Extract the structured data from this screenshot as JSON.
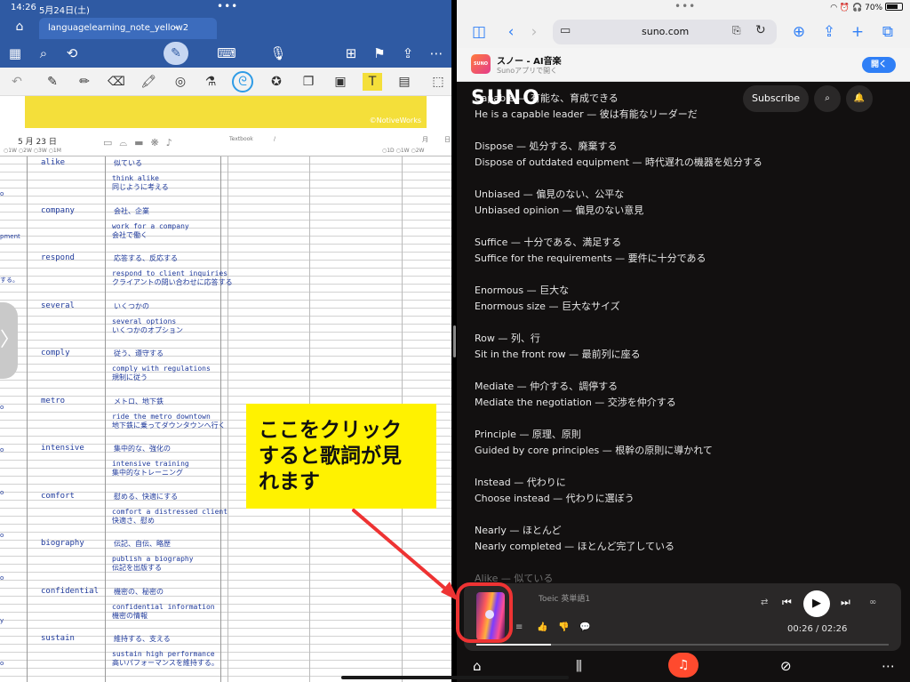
{
  "left": {
    "status": {
      "time": "14:26",
      "date": "5月24日(土)"
    },
    "tab_title": "languagelearning_note_yellow2",
    "watermark": "©NotiveWorks",
    "notebook": {
      "date_month": "5",
      "date_label": "月",
      "date_day": "23",
      "date_suffix": "日",
      "radios_left": "○1W  ○2W  ○3W  ○1M",
      "radios_right": "○1D  ○1W  ○2W",
      "textbook": "Textbook",
      "slash": "/",
      "right_month": "月",
      "right_day": "日"
    },
    "entries": [
      {
        "word": "alike",
        "meaning": "似ている",
        "ex1": "think alike",
        "ex2": "同じように考える"
      },
      {
        "word": "company",
        "meaning": "会社、企業",
        "ex1": "work for a company",
        "ex2": "会社で働く"
      },
      {
        "word": "respond",
        "meaning": "応答する、反応する",
        "ex1": "respond to client inquiries",
        "ex2": "クライアントの問い合わせに応答する"
      },
      {
        "word": "several",
        "meaning": "いくつかの",
        "ex1": "several options",
        "ex2": "いくつかのオプション"
      },
      {
        "word": "comply",
        "meaning": "従う、遵守する",
        "ex1": "comply with regulations",
        "ex2": "規制に従う"
      },
      {
        "word": "metro",
        "meaning": "メトロ、地下鉄",
        "ex1": "ride the metro downtown",
        "ex2": "地下鉄に乗ってダウンタウンへ行く"
      },
      {
        "word": "intensive",
        "meaning": "集中的な、強化の",
        "ex1": "intensive training",
        "ex2": "集中的なトレーニング"
      },
      {
        "word": "comfort",
        "meaning": "慰める、快適にする",
        "ex1": "comfort a distressed client",
        "ex2": "快適さ、慰め"
      },
      {
        "word": "biography",
        "meaning": "伝記、自伝、略歴",
        "ex1": "publish a biography",
        "ex2": "伝記を出版する"
      },
      {
        "word": "confidential",
        "meaning": "機密の、秘密の",
        "ex1": "confidential information",
        "ex2": "機密の情報"
      },
      {
        "word": "sustain",
        "meaning": "維持する、支える",
        "ex1": "sustain high performance",
        "ex2": "高いパフォーマンスを維持する。"
      }
    ],
    "edge_fragments": [
      "o",
      "pment",
      "する。",
      "o",
      "o",
      "o",
      "o",
      "o",
      "o",
      "o",
      "y",
      "o"
    ],
    "callout": [
      "ここをクリック",
      "すると歌詞が見",
      "れます"
    ]
  },
  "right": {
    "status": {
      "battery": "70%"
    },
    "url": "suno.com",
    "app_banner": {
      "title": "スノー - AI音楽",
      "subtitle": "Sunoアプリで開く",
      "open": "開く",
      "icon_text": "SUNO"
    },
    "header": {
      "logo": "SUNO",
      "subscribe": "Subscribe"
    },
    "lyrics": [
      {
        "text": "Capable — 有能な、育成できる",
        "dim": false
      },
      {
        "text": "He is a capable leader — 彼は有能なリーダーだ",
        "dim": false
      },
      {
        "text": "Dispose — 処分する、廃棄する",
        "dim": false
      },
      {
        "text": "Dispose of outdated equipment — 時代遅れの機器を処分する",
        "dim": false
      },
      {
        "text": "Unbiased — 偏見のない、公平な",
        "dim": false
      },
      {
        "text": "Unbiased opinion — 偏見のない意見",
        "dim": false
      },
      {
        "text": "Suffice — 十分である、満足する",
        "dim": false
      },
      {
        "text": "Suffice for the requirements — 要件に十分である",
        "dim": false
      },
      {
        "text": "Enormous — 巨大な",
        "dim": false
      },
      {
        "text": "Enormous size — 巨大なサイズ",
        "dim": false
      },
      {
        "text": "Row — 列、行",
        "dim": false
      },
      {
        "text": "Sit in the front row — 最前列に座る",
        "dim": false
      },
      {
        "text": "Mediate — 仲介する、調停する",
        "dim": false
      },
      {
        "text": "Mediate the negotiation — 交渉を仲介する",
        "dim": false
      },
      {
        "text": "Principle — 原理、原則",
        "dim": false
      },
      {
        "text": "Guided by core principles — 根幹の原則に導かれて",
        "dim": false
      },
      {
        "text": "Instead — 代わりに",
        "dim": false
      },
      {
        "text": "Choose instead — 代わりに選ぼう",
        "dim": false
      },
      {
        "text": "Nearly — ほとんど",
        "dim": false
      },
      {
        "text": "Nearly completed — ほとんど完了している",
        "dim": false
      },
      {
        "text": "Alike — 似ている",
        "dim": true
      }
    ],
    "player": {
      "title": "Toeic 英単語1",
      "time": "00:26 / 02:26",
      "progress": 0.18
    }
  },
  "colors": {
    "goodnotes_blue": "#2f5aa3",
    "suno_bg": "#121010",
    "accent_orange": "#ff4a2e",
    "callout_yellow": "#fff200",
    "highlight_red": "#e33"
  }
}
